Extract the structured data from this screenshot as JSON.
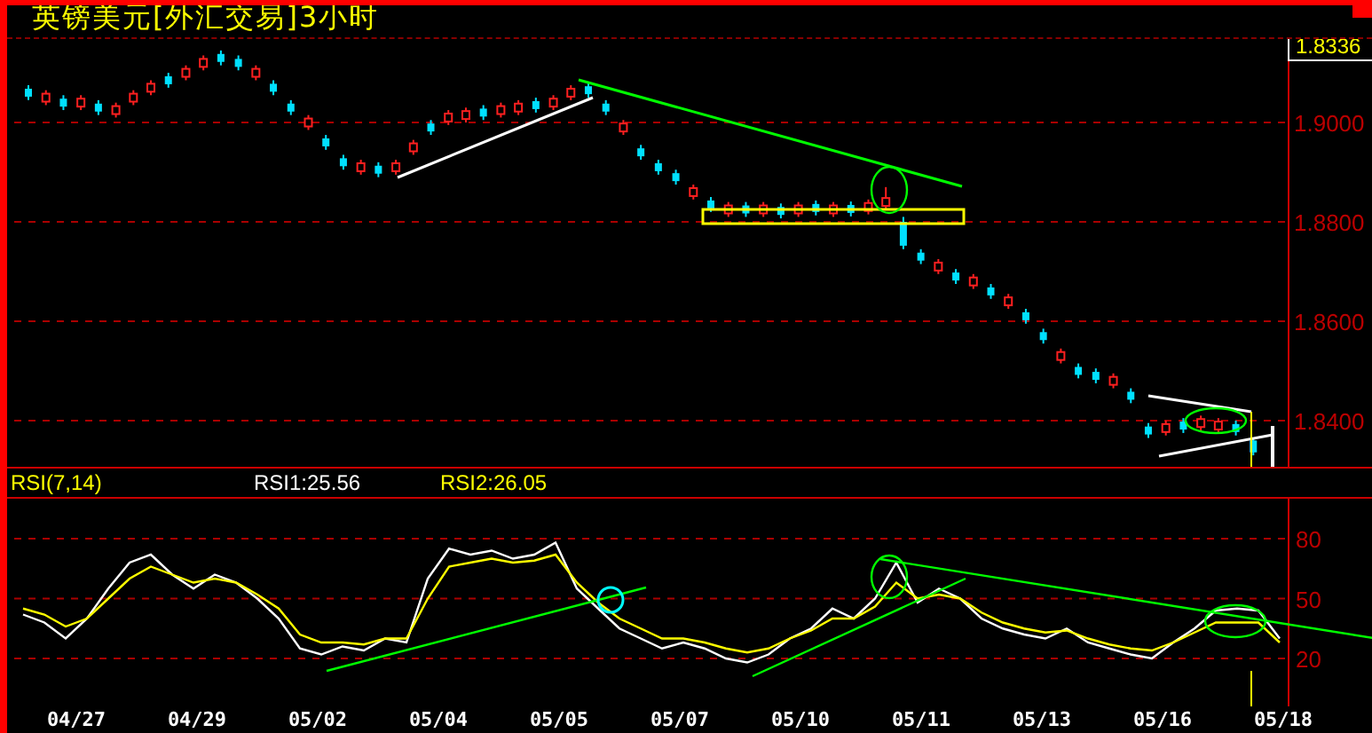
{
  "title": "英镑美元[外汇交易]3小时",
  "price_chart": {
    "current_price": "1.8336",
    "chart_data": {
      "type": "candlestick",
      "grid": true,
      "ylim": [
        1.8307,
        1.9168
      ],
      "yticks": [
        {
          "value": 1.9,
          "label": "1.9000"
        },
        {
          "value": 1.88,
          "label": "1.8800"
        },
        {
          "value": 1.86,
          "label": "1.8600"
        },
        {
          "value": 1.84,
          "label": "1.8400"
        }
      ],
      "ohlc": [
        [
          1.9068,
          1.9075,
          1.9045,
          1.9052
        ],
        [
          1.9042,
          1.9065,
          1.9035,
          1.9058
        ],
        [
          1.9048,
          1.9055,
          1.9025,
          1.9032
        ],
        [
          1.9032,
          1.9055,
          1.9025,
          1.9048
        ],
        [
          1.9038,
          1.9045,
          1.9015,
          1.9022
        ],
        [
          1.9017,
          1.904,
          1.901,
          1.9033
        ],
        [
          1.9042,
          1.9065,
          1.9035,
          1.9058
        ],
        [
          1.9062,
          1.9085,
          1.9055,
          1.9078
        ],
        [
          1.9093,
          1.91,
          1.907,
          1.9077
        ],
        [
          1.9092,
          1.9115,
          1.9085,
          1.9108
        ],
        [
          1.9112,
          1.9135,
          1.9105,
          1.9128
        ],
        [
          1.9138,
          1.9145,
          1.9115,
          1.9122
        ],
        [
          1.9128,
          1.9135,
          1.9105,
          1.9112
        ],
        [
          1.9092,
          1.9115,
          1.9085,
          1.9108
        ],
        [
          1.9078,
          1.9085,
          1.9055,
          1.9062
        ],
        [
          1.9038,
          1.9045,
          1.9015,
          1.9022
        ],
        [
          1.8992,
          1.9015,
          1.8985,
          1.9008
        ],
        [
          1.8968,
          1.8975,
          1.8945,
          1.8952
        ],
        [
          1.8928,
          1.8935,
          1.8905,
          1.8912
        ],
        [
          1.8902,
          1.8925,
          1.8895,
          1.8918
        ],
        [
          1.8913,
          1.892,
          1.889,
          1.8897
        ],
        [
          1.8902,
          1.8925,
          1.8895,
          1.8918
        ],
        [
          1.8942,
          1.8965,
          1.8935,
          1.8958
        ],
        [
          1.8998,
          1.9005,
          1.8975,
          1.8982
        ],
        [
          1.9002,
          1.9025,
          1.8995,
          1.9018
        ],
        [
          1.9007,
          1.903,
          1.9,
          1.9023
        ],
        [
          1.9028,
          1.9035,
          1.9005,
          1.9012
        ],
        [
          1.9017,
          1.904,
          1.901,
          1.9033
        ],
        [
          1.9022,
          1.9045,
          1.9015,
          1.9038
        ],
        [
          1.9043,
          1.905,
          1.902,
          1.9027
        ],
        [
          1.9032,
          1.9055,
          1.9025,
          1.9048
        ],
        [
          1.9052,
          1.9075,
          1.9045,
          1.9068
        ],
        [
          1.9073,
          1.908,
          1.905,
          1.9057
        ],
        [
          1.9038,
          1.9045,
          1.9015,
          1.9022
        ],
        [
          1.8982,
          1.9005,
          1.8975,
          1.8998
        ],
        [
          1.8948,
          1.8955,
          1.8925,
          1.8932
        ],
        [
          1.8918,
          1.8925,
          1.8895,
          1.8902
        ],
        [
          1.8898,
          1.8905,
          1.8875,
          1.8882
        ],
        [
          1.8852,
          1.8875,
          1.8845,
          1.8868
        ],
        [
          1.8843,
          1.885,
          1.882,
          1.8827
        ],
        [
          1.8817,
          1.884,
          1.881,
          1.8833
        ],
        [
          1.8833,
          1.884,
          1.881,
          1.8817
        ],
        [
          1.8817,
          1.884,
          1.881,
          1.8833
        ],
        [
          1.883,
          1.8837,
          1.8807,
          1.8814
        ],
        [
          1.8817,
          1.884,
          1.881,
          1.8833
        ],
        [
          1.8836,
          1.8843,
          1.8813,
          1.882
        ],
        [
          1.8817,
          1.884,
          1.881,
          1.8833
        ],
        [
          1.8834,
          1.8841,
          1.8811,
          1.8818
        ],
        [
          1.8822,
          1.8845,
          1.8815,
          1.8838
        ],
        [
          1.8832,
          1.887,
          1.8825,
          1.8848
        ],
        [
          1.88,
          1.881,
          1.8745,
          1.8752
        ],
        [
          1.8738,
          1.8745,
          1.8715,
          1.8722
        ],
        [
          1.8702,
          1.8725,
          1.8695,
          1.8718
        ],
        [
          1.8698,
          1.8705,
          1.8675,
          1.8682
        ],
        [
          1.8672,
          1.8695,
          1.8665,
          1.8688
        ],
        [
          1.8668,
          1.8675,
          1.8645,
          1.8652
        ],
        [
          1.8632,
          1.8655,
          1.8625,
          1.8648
        ],
        [
          1.8618,
          1.8625,
          1.8595,
          1.8602
        ],
        [
          1.8578,
          1.8585,
          1.8555,
          1.8562
        ],
        [
          1.8522,
          1.8545,
          1.8515,
          1.8538
        ],
        [
          1.8508,
          1.8515,
          1.8485,
          1.8492
        ],
        [
          1.8498,
          1.8505,
          1.8475,
          1.8482
        ],
        [
          1.8472,
          1.8495,
          1.8465,
          1.8488
        ],
        [
          1.8458,
          1.8465,
          1.8435,
          1.8442
        ],
        [
          1.8388,
          1.8395,
          1.8365,
          1.8372
        ],
        [
          1.8377,
          1.84,
          1.837,
          1.8393
        ],
        [
          1.8398,
          1.8405,
          1.8375,
          1.8382
        ],
        [
          1.8387,
          1.841,
          1.838,
          1.8403
        ],
        [
          1.8382,
          1.8405,
          1.8375,
          1.8398
        ],
        [
          1.8393,
          1.84,
          1.837,
          1.8377
        ],
        [
          1.836,
          1.8365,
          1.833,
          1.8336
        ]
      ]
    }
  },
  "rsi": {
    "label": "RSI(7,14)",
    "readings": [
      {
        "text": "RSI1:25.56",
        "color": "#ffffff"
      },
      {
        "text": "RSI2:26.05",
        "color": "#ffff00"
      }
    ],
    "chart_data": {
      "type": "line",
      "grid": true,
      "ylim": [
        -4,
        100
      ],
      "yticks": [
        20,
        50,
        80
      ],
      "series": [
        {
          "color": "#ffffff",
          "values": [
            42,
            38,
            30,
            40,
            55,
            68,
            72,
            62,
            55,
            62,
            58,
            50,
            40,
            25,
            22,
            26,
            24,
            30,
            28,
            60,
            75,
            72,
            74,
            70,
            72,
            78,
            55,
            45,
            35,
            30,
            25,
            28,
            25,
            20,
            18,
            22,
            30,
            35,
            45,
            40,
            50,
            68,
            48,
            55,
            50,
            40,
            35,
            32,
            30,
            35,
            28,
            25,
            22,
            20,
            28,
            35,
            44,
            45,
            44,
            30
          ]
        },
        {
          "color": "#ffff00",
          "values": [
            45,
            42,
            36,
            40,
            50,
            60,
            66,
            62,
            58,
            60,
            58,
            52,
            45,
            32,
            28,
            28,
            27,
            30,
            30,
            50,
            66,
            68,
            70,
            68,
            69,
            72,
            58,
            48,
            40,
            35,
            30,
            30,
            28,
            25,
            23,
            25,
            30,
            34,
            40,
            40,
            46,
            58,
            50,
            52,
            50,
            43,
            38,
            35,
            33,
            34,
            30,
            27,
            25,
            24,
            28,
            33,
            38,
            38,
            38,
            28
          ]
        }
      ]
    }
  },
  "dates": [
    "04/27",
    "04/29",
    "05/02",
    "05/04",
    "05/05",
    "05/07",
    "05/10",
    "05/11",
    "05/13",
    "05/16",
    "05/18"
  ]
}
